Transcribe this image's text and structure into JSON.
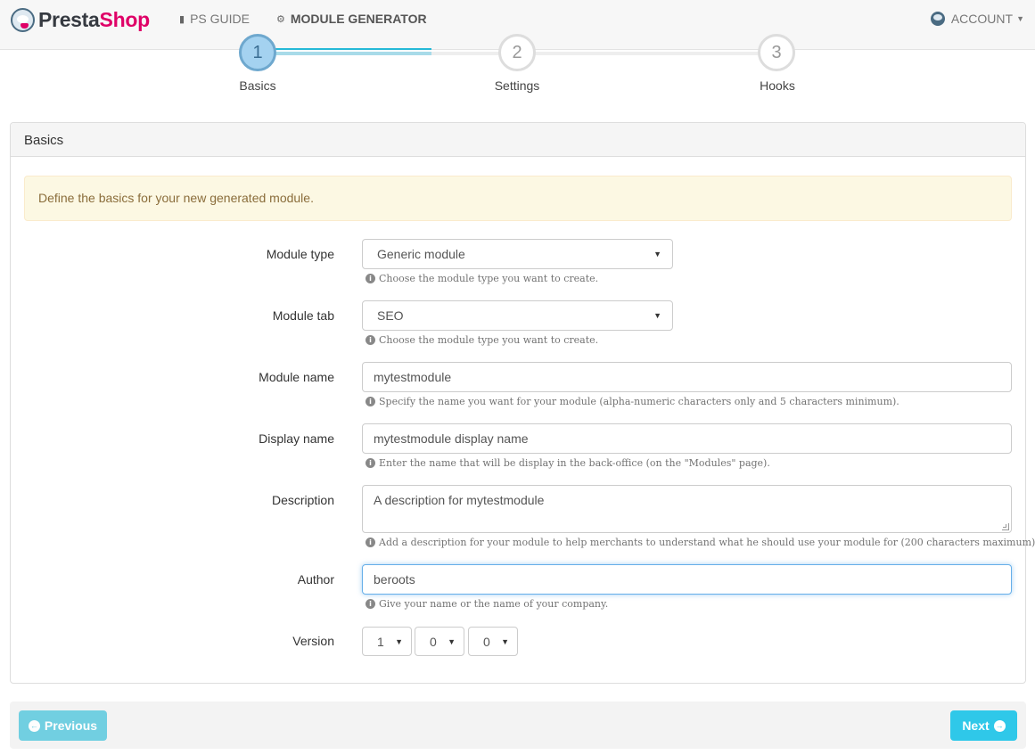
{
  "navbar": {
    "brand_first": "Presta",
    "brand_second": "Shop",
    "links": [
      {
        "label": "PS GUIDE",
        "icon": "book-icon"
      },
      {
        "label": "MODULE GENERATOR",
        "icon": "gears-icon"
      }
    ],
    "account_label": "ACCOUNT",
    "accent_color": "#25b9d7",
    "brand_color": "#df0067"
  },
  "steps": [
    {
      "number": "1",
      "label": "Basics",
      "active": true
    },
    {
      "number": "2",
      "label": "Settings",
      "active": false
    },
    {
      "number": "3",
      "label": "Hooks",
      "active": false
    }
  ],
  "panel": {
    "title": "Basics",
    "alert": "Define the basics for your new generated module."
  },
  "form": {
    "module_type": {
      "label": "Module type",
      "value": "Generic module",
      "help": "Choose the module type you want to create."
    },
    "module_tab": {
      "label": "Module tab",
      "value": "SEO",
      "help": "Choose the module type you want to create."
    },
    "module_name": {
      "label": "Module name",
      "value": "mytestmodule",
      "help": "Specify the name you want for your module (alpha-numeric characters only and 5 characters minimum)."
    },
    "display_name": {
      "label": "Display name",
      "value": "mytestmodule display name",
      "help": "Enter the name that will be display in the back-office (on the \"Modules\" page)."
    },
    "description": {
      "label": "Description",
      "value": "A description for mytestmodule",
      "help": "Add a description for your module to help merchants to understand what he should use your module for (200 characters maximum)."
    },
    "author": {
      "label": "Author",
      "value": "beroots",
      "help": "Give your name or the name of your company."
    },
    "version": {
      "label": "Version",
      "major": "1",
      "minor": "0",
      "patch": "0"
    }
  },
  "footer": {
    "previous_label": "Previous",
    "next_label": "Next"
  }
}
